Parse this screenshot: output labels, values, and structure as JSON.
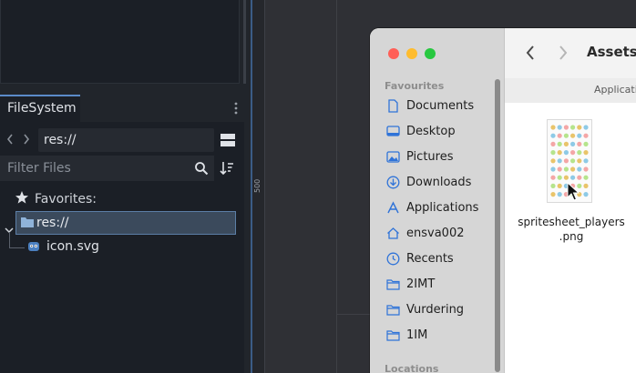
{
  "godot": {
    "filesystem_tab": "FileSystem",
    "path_value": "res://",
    "filter_placeholder": "Filter Files",
    "favorites_label": "Favorites:",
    "tree": [
      {
        "label": "res://",
        "selected": true
      },
      {
        "label": "icon.svg"
      }
    ],
    "ruler_label": "500",
    "accent_color": "#5b8bc9"
  },
  "finder": {
    "title": "Assets",
    "column_header": "Applicatio",
    "sidebar": {
      "favourites_title": "Favourites",
      "items": [
        {
          "label": "Documents",
          "icon": "document-icon"
        },
        {
          "label": "Desktop",
          "icon": "desktop-icon"
        },
        {
          "label": "Pictures",
          "icon": "pictures-icon"
        },
        {
          "label": "Downloads",
          "icon": "downloads-icon"
        },
        {
          "label": "Applications",
          "icon": "applications-icon"
        },
        {
          "label": "ensva002",
          "icon": "home-icon"
        },
        {
          "label": "Recents",
          "icon": "recents-icon"
        },
        {
          "label": "2IMT",
          "icon": "folder-icon"
        },
        {
          "label": "Vurdering",
          "icon": "folder-icon"
        },
        {
          "label": "1IM",
          "icon": "folder-icon"
        }
      ],
      "locations_title": "Locations"
    },
    "file": {
      "name_line1": "spritesheet_players",
      "name_line2": ".png"
    }
  }
}
